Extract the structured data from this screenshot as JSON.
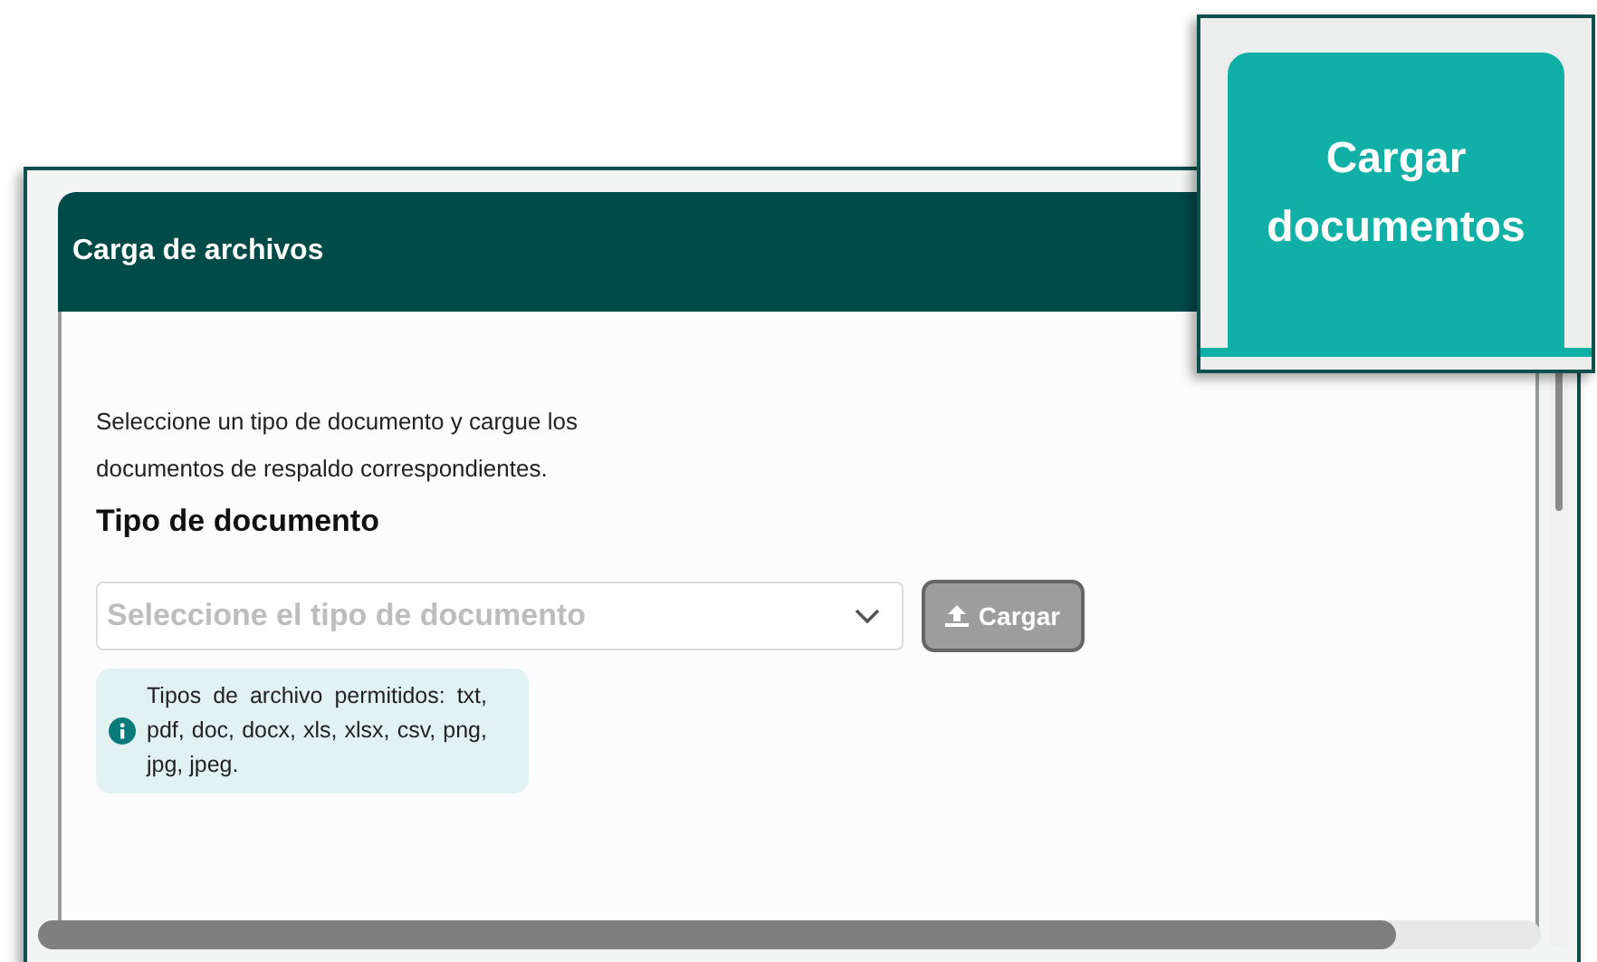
{
  "panel": {
    "title": "Carga de archivos"
  },
  "intro": "Seleccione un tipo de documento y cargue los documentos de respaldo correspondientes.",
  "section_title": "Tipo de documento",
  "select": {
    "placeholder": "Seleccione el tipo de documento"
  },
  "upload_button": {
    "label": "Cargar",
    "disabled": true
  },
  "info": "Tipos de archivo permitidos: txt, pdf, doc, docx, xls, xlsx, csv, png, jpg, jpeg.",
  "callout": {
    "label": "Cargar documentos"
  }
}
